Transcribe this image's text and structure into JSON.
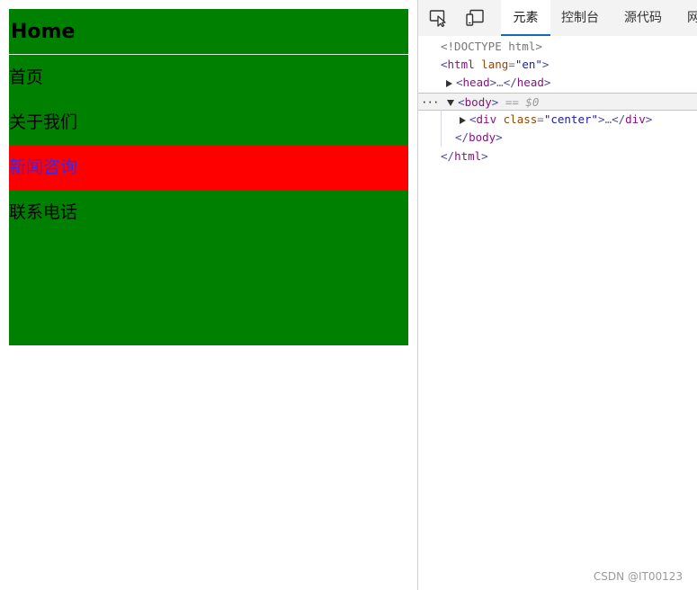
{
  "page": {
    "title": "Home",
    "nav": [
      {
        "label": "首页",
        "active": false
      },
      {
        "label": "关于我们",
        "active": false
      },
      {
        "label": "新闻咨询",
        "active": true
      },
      {
        "label": "联系电话",
        "active": false
      }
    ],
    "colors": {
      "box": "#008000",
      "active_bg": "#ff0000",
      "active_text": "#2b2bff"
    }
  },
  "devtools": {
    "icons": [
      "inspect-element-icon",
      "device-toolbar-icon"
    ],
    "tabs": [
      {
        "label": "元素",
        "active": true
      },
      {
        "label": "控制台",
        "active": false
      },
      {
        "label": "源代码",
        "active": false
      },
      {
        "label": "网",
        "active": false
      }
    ],
    "dom": {
      "doctype": "<!DOCTYPE html>",
      "html_tag": "html",
      "lang_attr": "lang",
      "lang_val": "\"en\"",
      "head_tag": "head",
      "ellipsis": "…",
      "body_tag": "body",
      "selected_marker": "== $0",
      "more_dots": "···",
      "div_tag": "div",
      "class_attr": "class",
      "class_val": "\"center\"",
      "lt": "<",
      "gt": ">",
      "close_lt": "</",
      "eq": "="
    }
  },
  "watermark": "CSDN @IT00123"
}
